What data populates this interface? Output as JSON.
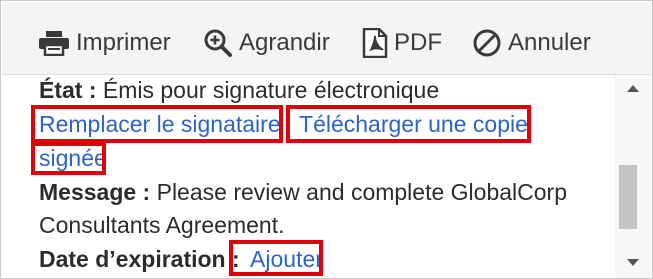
{
  "toolbar": {
    "print_label": "Imprimer",
    "zoom_label": "Agrandir",
    "pdf_label": "PDF",
    "cancel_label": "Annuler"
  },
  "agreement": {
    "status_label": "État :",
    "status_value": "Émis pour signature électronique",
    "replace_signer_link": "Remplacer le signataire",
    "download_link_part1": "Télécharger une copie",
    "download_link_part2": "signée",
    "message_label": "Message :",
    "message_line1": "Please review and complete GlobalCorp",
    "message_line2": "Consultants Agreement.",
    "expiration_label": "Date d’expiration :",
    "add_link": "Ajouter"
  },
  "colors": {
    "link": "#2d64c2",
    "highlight": "#e0000b",
    "toolbar_bg": "#f4f4f4"
  },
  "icons": {
    "print": "printer-icon",
    "zoom": "zoom-in-icon",
    "pdf": "pdf-icon",
    "cancel": "cancel-icon",
    "scroll_up": "scroll-up-arrow-icon",
    "scroll_down": "scroll-down-arrow-icon"
  }
}
